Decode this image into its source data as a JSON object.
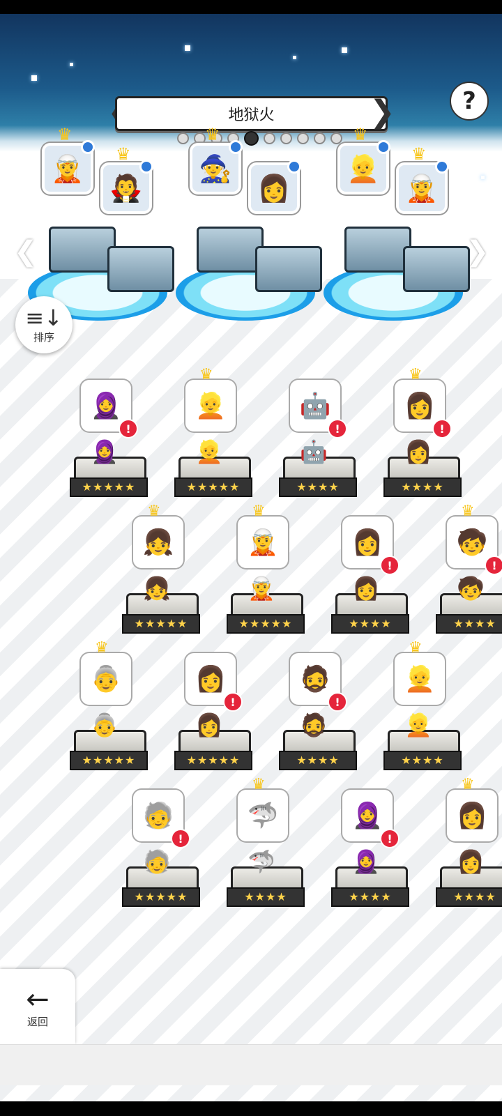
{
  "header": {
    "title": "地狱火",
    "page_count": 10,
    "active_page": 4
  },
  "buttons": {
    "help": "?",
    "sort_label": "排序",
    "back_label": "返回"
  },
  "icons": {
    "sort": "sort-icon",
    "back": "back-arrow-icon",
    "help": "question-icon"
  },
  "teams": [
    {
      "members": [
        {
          "face": "🧝",
          "crown": true,
          "selected": true
        },
        {
          "face": "🧛",
          "crown": true,
          "selected": true
        }
      ]
    },
    {
      "members": [
        {
          "face": "🧙",
          "crown": true,
          "selected": true
        },
        {
          "face": "👩",
          "crown": false,
          "selected": true
        }
      ]
    },
    {
      "members": [
        {
          "face": "👱",
          "crown": true,
          "selected": true
        },
        {
          "face": "🧝",
          "crown": true,
          "selected": true
        }
      ]
    }
  ],
  "roster": [
    {
      "face": "🧕",
      "crown": false,
      "alert": true,
      "stars": "★★★★★"
    },
    {
      "face": "👱",
      "crown": true,
      "alert": false,
      "stars": "★★★★★"
    },
    {
      "face": "🤖",
      "crown": false,
      "alert": true,
      "stars": "★★★★"
    },
    {
      "face": "👩",
      "crown": true,
      "alert": true,
      "stars": "★★★★"
    },
    {
      "face": "👧",
      "crown": true,
      "alert": false,
      "stars": "★★★★★"
    },
    {
      "face": "🧝",
      "crown": true,
      "alert": false,
      "stars": "★★★★★"
    },
    {
      "face": "👩",
      "crown": false,
      "alert": true,
      "stars": "★★★★"
    },
    {
      "face": "🧒",
      "crown": true,
      "alert": true,
      "stars": "★★★★"
    },
    {
      "face": "👵",
      "crown": true,
      "alert": false,
      "stars": "★★★★★"
    },
    {
      "face": "👩",
      "crown": false,
      "alert": true,
      "stars": "★★★★★"
    },
    {
      "face": "🧔",
      "crown": false,
      "alert": true,
      "stars": "★★★★"
    },
    {
      "face": "👱",
      "crown": true,
      "alert": false,
      "stars": "★★★★"
    },
    {
      "face": "🧓",
      "crown": false,
      "alert": true,
      "stars": "★★★★★"
    },
    {
      "face": "🦈",
      "crown": true,
      "alert": false,
      "stars": "★★★★"
    },
    {
      "face": "🧕",
      "crown": false,
      "alert": true,
      "stars": "★★★★"
    },
    {
      "face": "👩",
      "crown": true,
      "alert": false,
      "stars": "★★★★"
    }
  ]
}
